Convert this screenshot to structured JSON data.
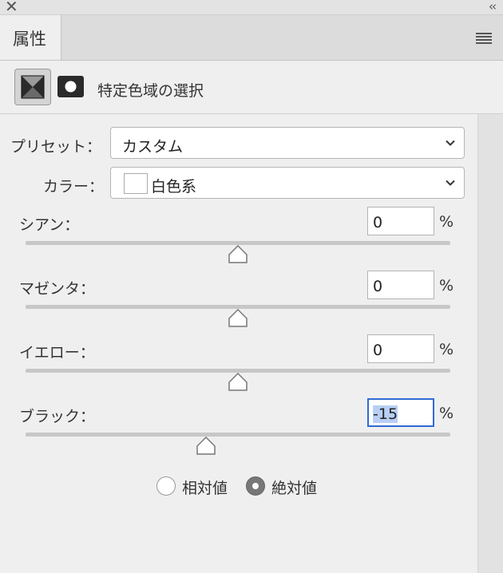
{
  "window": {
    "close_icon": "close-icon",
    "collapse_icon": "double-chevron-left-icon"
  },
  "panel": {
    "tab_label": "属性",
    "menu_icon": "panel-menu-icon"
  },
  "header": {
    "title": "特定色域の選択",
    "adjustment_icon": "selective-color-adjustment-icon",
    "mask_icon": "layer-mask-icon"
  },
  "preset": {
    "label": "プリセット：",
    "value": "カスタム"
  },
  "colors": {
    "label": "カラー：",
    "value": "白色系",
    "swatch_color": "#ffffff"
  },
  "sliders": [
    {
      "label": "シアン：",
      "value": "0",
      "unit": "%",
      "position": 0.5
    },
    {
      "label": "マゼンタ：",
      "value": "0",
      "unit": "%",
      "position": 0.5
    },
    {
      "label": "イエロー：",
      "value": "0",
      "unit": "%",
      "position": 0.5
    },
    {
      "label": "ブラック：",
      "value": "-15",
      "unit": "%",
      "position": 0.425
    }
  ],
  "method": {
    "options": [
      {
        "label": "相対値",
        "selected": false
      },
      {
        "label": "絶対値",
        "selected": true
      }
    ]
  },
  "colors_theme": {
    "focus": "#2f6ad6",
    "selection": "#b8cff4"
  }
}
